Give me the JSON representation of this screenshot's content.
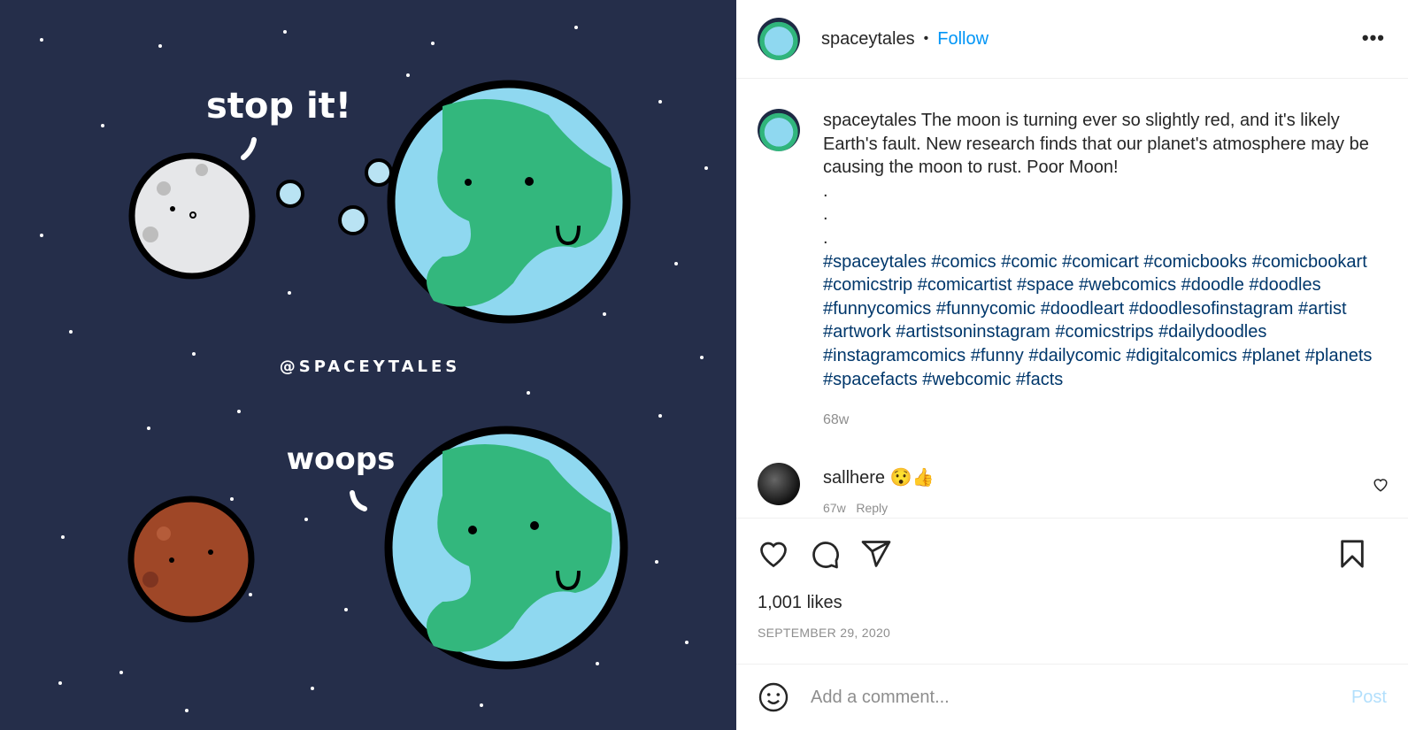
{
  "media": {
    "background": "#252e4a",
    "comic_texts": {
      "top_speech": "stop it!",
      "watermark": "@SPACEYTALES",
      "bottom_speech": "woops"
    }
  },
  "header": {
    "username": "spaceytales",
    "separator": "•",
    "follow_label": "Follow",
    "more_icon": "more-horizontal-icon"
  },
  "caption": {
    "username": "spaceytales",
    "text": "The moon is turning ever so slightly red, and it's likely Earth's fault. New research finds that our planet's atmosphere may be causing the moon to rust. Poor Moon!",
    "dots": [
      ".",
      ".",
      "."
    ],
    "hashtags": [
      "#spaceytales",
      "#comics",
      "#comic",
      "#comicart",
      "#comicbooks",
      "#comicbookart",
      "#comicstrip",
      "#comicartist",
      "#space",
      "#webcomics",
      "#doodle",
      "#doodles",
      "#funnycomics",
      "#funnycomic",
      "#doodleart",
      "#doodlesofinstagram",
      "#artist",
      "#artwork",
      "#artistsoninstagram",
      "#comicstrips",
      "#dailydoodles",
      "#instagramcomics",
      "#funny",
      "#dailycomic",
      "#digitalcomics",
      "#planet",
      "#planets",
      "#spacefacts",
      "#webcomic",
      "#facts"
    ],
    "time": "68w"
  },
  "comments": [
    {
      "username": "sallhere",
      "text": "😯👍",
      "time": "67w",
      "reply_label": "Reply"
    }
  ],
  "actions": {
    "like_icon": "heart-icon",
    "comment_icon": "comment-icon",
    "share_icon": "paper-plane-icon",
    "save_icon": "bookmark-icon"
  },
  "likes": "1,001 likes",
  "date": "SEPTEMBER 29, 2020",
  "add_comment": {
    "placeholder": "Add a comment...",
    "post_label": "Post",
    "emoji_icon": "smiley-icon"
  },
  "colors": {
    "accent": "#0095f6",
    "hashtag": "#00376b",
    "muted": "#8e8e8e",
    "post_disabled": "#b2dffc"
  }
}
